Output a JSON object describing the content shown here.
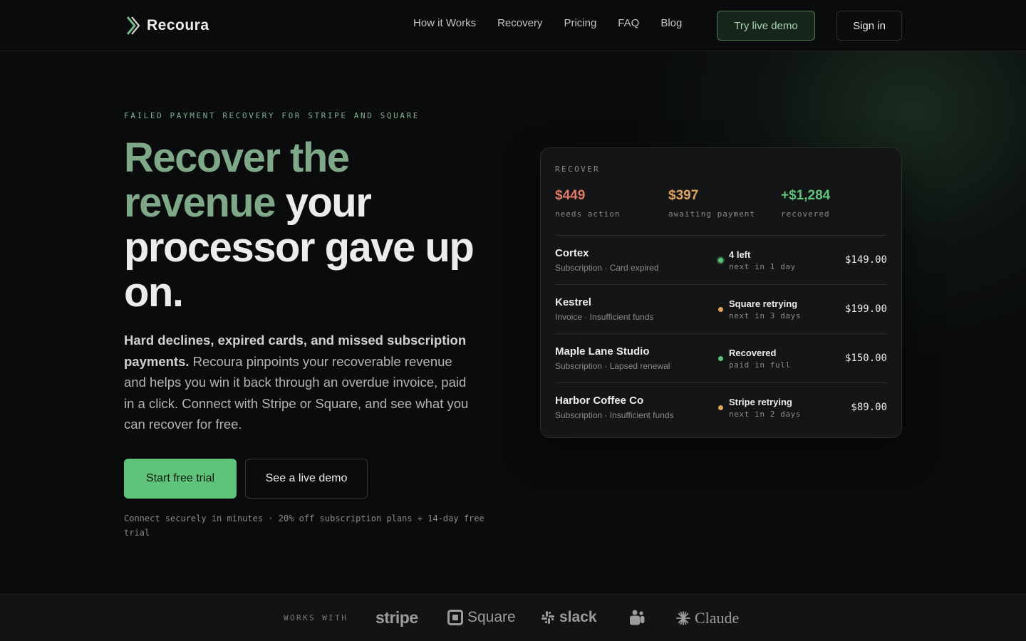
{
  "nav": {
    "brand": "Recoura",
    "links": [
      "How it Works",
      "Recovery",
      "Pricing",
      "FAQ",
      "Blog"
    ],
    "demo_label": "Try live demo",
    "signin_label": "Sign in"
  },
  "hero": {
    "eyebrow": "FAILED PAYMENT RECOVERY FOR STRIPE AND SQUARE",
    "headline_accent": "Recover the revenue",
    "headline_rest": " your processor gave up on.",
    "sub_bold": "Hard declines, expired cards, and missed subscription payments.",
    "sub_rest": " Recoura pinpoints your recoverable revenue and helps you win it back through an overdue invoice, paid in a click. Connect with Stripe or Square, and see what you can recover for free.",
    "cta_primary": "Start free trial",
    "cta_secondary": "See a live demo",
    "fineprint": "Connect securely in minutes · 20% off subscription plans + 14-day free trial"
  },
  "card": {
    "label": "RECOVER",
    "stats": [
      {
        "value": "$449",
        "label": "needs action",
        "color": "#e07a66"
      },
      {
        "value": "$397",
        "label": "awaiting payment",
        "color": "#e0a35c"
      },
      {
        "value": "+$1,284",
        "label": "recovered",
        "color": "#5fc47a"
      }
    ],
    "rows": [
      {
        "name": "Cortex",
        "meta": "Subscription · Card expired",
        "status": "4 left",
        "next": "next in 1 day",
        "amount": "$149.00",
        "dot": "#5fc47a",
        "ring": true
      },
      {
        "name": "Kestrel",
        "meta": "Invoice · Insufficient funds",
        "status": "Square retrying",
        "next": "next in 3 days",
        "amount": "$199.00",
        "dot": "#e0a35c",
        "ring": false
      },
      {
        "name": "Maple Lane Studio",
        "meta": "Subscription · Lapsed renewal",
        "status": "Recovered",
        "next": "paid in full",
        "amount": "$150.00",
        "dot": "#5fc47a",
        "ring": false
      },
      {
        "name": "Harbor Coffee Co",
        "meta": "Subscription · Insufficient funds",
        "status": "Stripe retrying",
        "next": "next in 2 days",
        "amount": "$89.00",
        "dot": "#e0a35c",
        "ring": false
      }
    ]
  },
  "footer": {
    "works_with": "WORKS WITH",
    "partners": [
      {
        "name": "stripe",
        "icon": "stripe-logo"
      },
      {
        "name": "Square",
        "icon": "square-logo"
      },
      {
        "name": "slack",
        "icon": "slack-logo"
      },
      {
        "name": "",
        "icon": "teams-logo"
      },
      {
        "name": "Claude",
        "icon": "claude-logo"
      }
    ]
  }
}
